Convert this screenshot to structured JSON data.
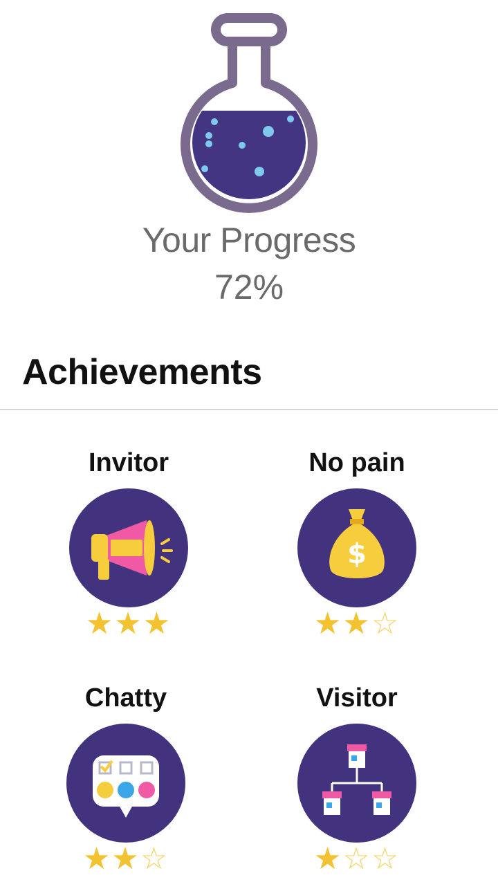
{
  "progress": {
    "title": "Your Progress",
    "value_label": "72%",
    "fraction": 0.72,
    "flask_icon": "chemistry-flask-icon"
  },
  "achievements": {
    "title": "Achievements",
    "items": [
      {
        "label": "Invitor",
        "icon": "megaphone-icon",
        "stars": 3,
        "max_stars": 3
      },
      {
        "label": "No pain",
        "icon": "money-bag-icon",
        "stars": 2,
        "max_stars": 3
      },
      {
        "label": "Chatty",
        "icon": "chat-bubble-icon",
        "stars": 2,
        "max_stars": 3
      },
      {
        "label": "Visitor",
        "icon": "store-network-icon",
        "stars": 1,
        "max_stars": 3
      }
    ]
  },
  "colors": {
    "flask_outline": "#7a6a8d",
    "liquid": "#443582",
    "bubble": "#7fc9ef",
    "badge_bg": "#43327e",
    "star": "#f2c231"
  }
}
